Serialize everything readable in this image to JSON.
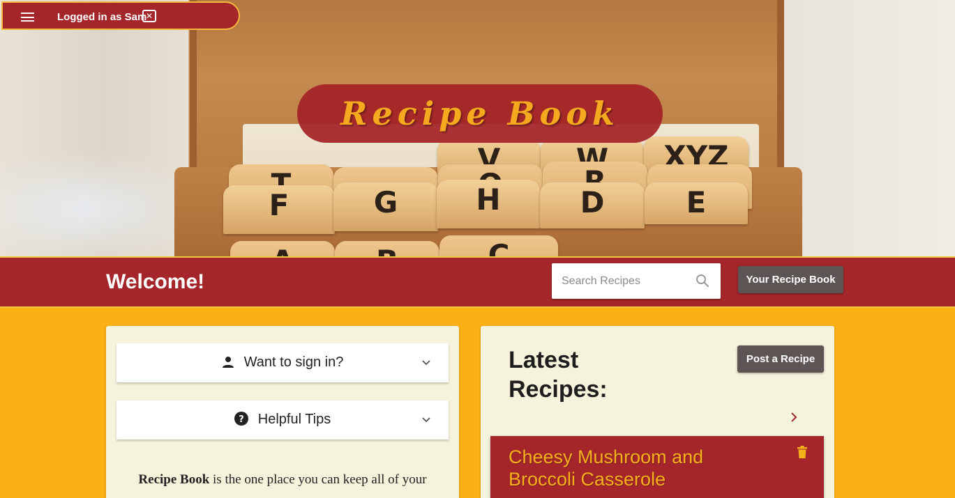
{
  "header": {
    "user_status": "Logged in as Sam",
    "app_title": "Recipe Book"
  },
  "hero": {
    "tabs_row1": [
      "V",
      "W",
      "XYZ"
    ],
    "tabs_row2": [
      "T",
      "",
      "O",
      "R",
      ""
    ],
    "tabs_row3": [
      "F",
      "G",
      "H",
      "D",
      "E"
    ],
    "tabs_row4": [
      "A",
      "B",
      "C"
    ]
  },
  "welcome_bar": {
    "title": "Welcome!",
    "search_placeholder": "Search Recipes",
    "recipe_book_button": "Your Recipe Book"
  },
  "left_panel": {
    "sign_in_label": "Want to sign in?",
    "tips_label": "Helpful Tips",
    "intro_bold": "Recipe Book",
    "intro_rest": " is the one place you can keep all of your"
  },
  "right_panel": {
    "latest_title": "Latest Recipes:",
    "post_button": "Post a Recipe",
    "recipes": [
      {
        "title": "Cheesy Mushroom and Broccoli Casserole"
      }
    ]
  },
  "colors": {
    "brand_red": "#a4262a",
    "accent_gold": "#fbb013",
    "panel_cream": "#f5f3dc",
    "button_gray": "#5c5554"
  }
}
